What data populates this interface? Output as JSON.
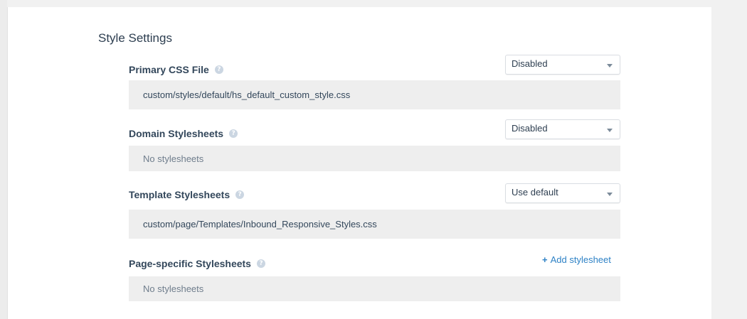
{
  "section": {
    "title": "Style Settings"
  },
  "rows": [
    {
      "label": "Primary CSS File",
      "dropdown": "Disabled",
      "value": "custom/styles/default/hs_default_custom_style.css"
    },
    {
      "label": "Domain Stylesheets",
      "dropdown": "Disabled",
      "value": "No stylesheets"
    },
    {
      "label": "Template Stylesheets",
      "dropdown": "Use default",
      "value": "custom/page/Templates/Inbound_Responsive_Styles.css"
    },
    {
      "label": "Page-specific Stylesheets",
      "action": "Add stylesheet",
      "value": "No stylesheets"
    }
  ],
  "icons": {
    "help": "?",
    "add": "+"
  },
  "colors": {
    "link": "#2e82c6",
    "well": "#eeeeee",
    "page_bg": "#f1f1f1"
  }
}
